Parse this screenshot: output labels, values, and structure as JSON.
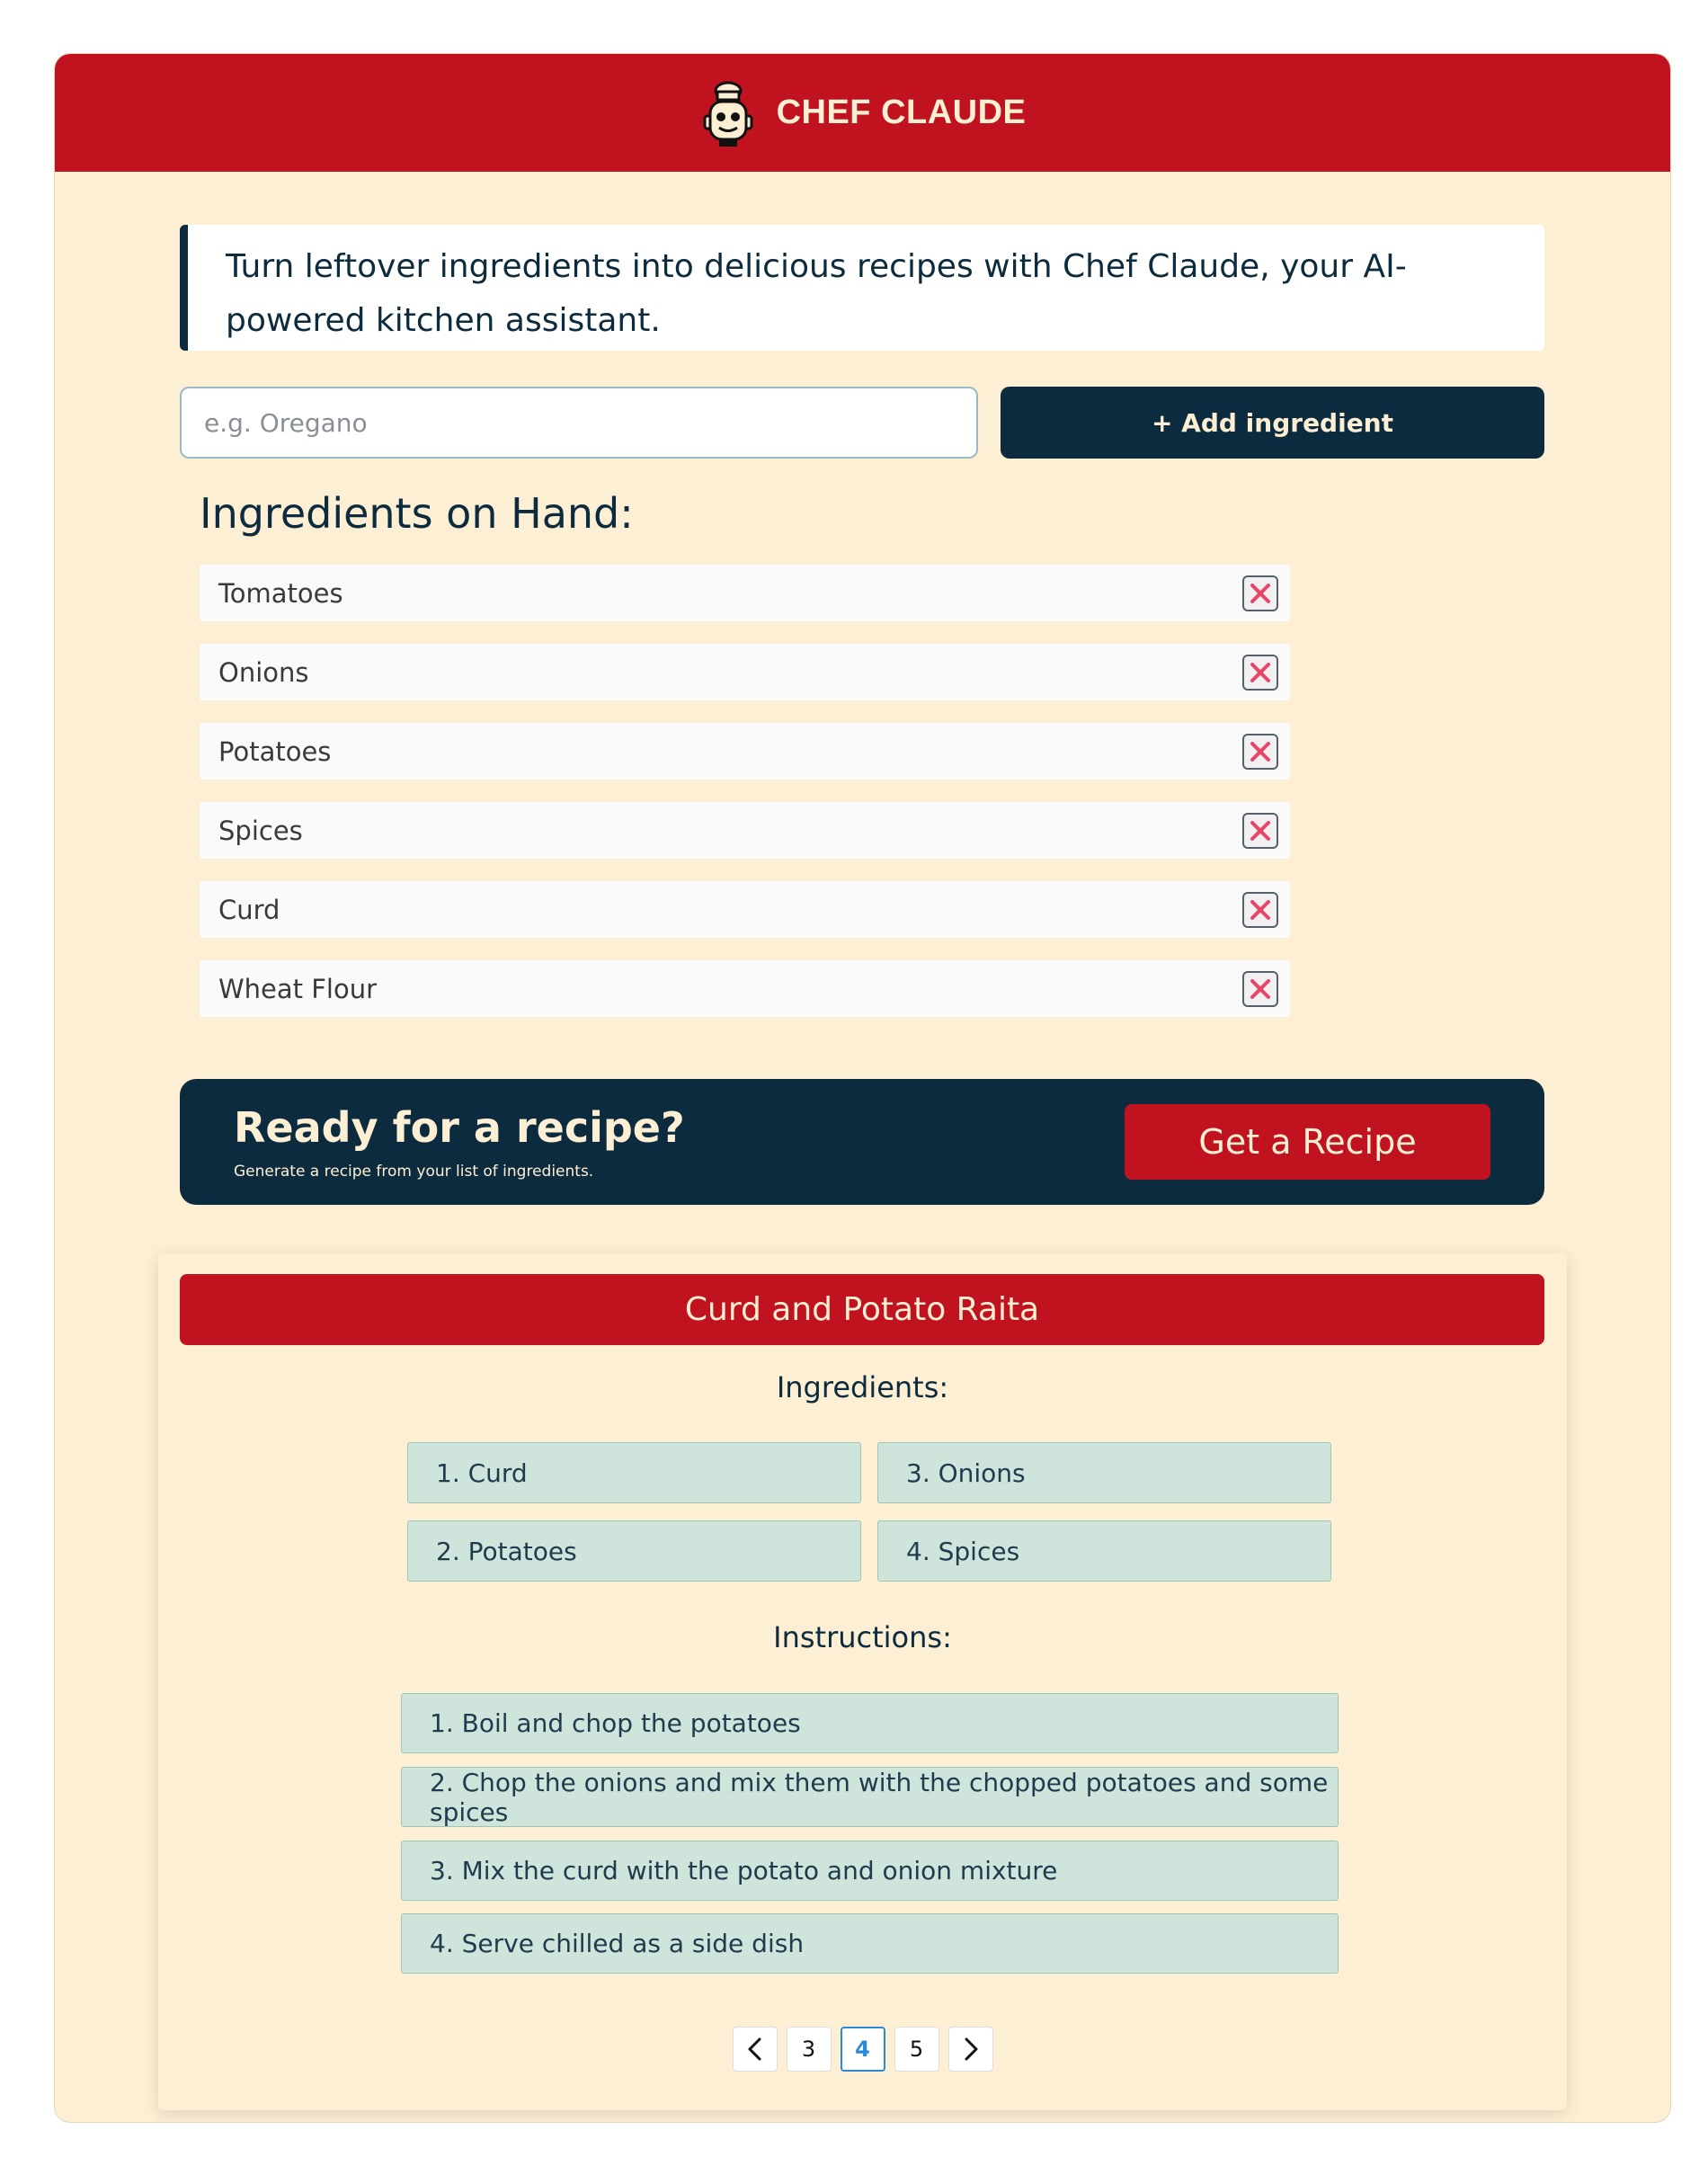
{
  "header": {
    "brand": "CHEF CLAUDE",
    "logo_icon": "chef-robot-icon"
  },
  "intro": {
    "text": "Turn leftover ingredients into delicious recipes with Chef Claude, your AI-powered kitchen assistant."
  },
  "ingredient_input": {
    "placeholder": "e.g. Oregano",
    "value": ""
  },
  "add_button": {
    "label": "+ Add ingredient"
  },
  "ingredients_list": {
    "title": "Ingredients on Hand:",
    "items": [
      {
        "name": "Tomatoes"
      },
      {
        "name": "Onions"
      },
      {
        "name": "Potatoes"
      },
      {
        "name": "Spices"
      },
      {
        "name": "Curd"
      },
      {
        "name": "Wheat Flour"
      }
    ]
  },
  "cta": {
    "title": "Ready for a recipe?",
    "subtitle": "Generate a recipe from your list of ingredients.",
    "button_label": "Get a Recipe"
  },
  "recipe": {
    "title": "Curd and Potato Raita",
    "ingredients_title": "Ingredients:",
    "ingredients": [
      "1. Curd",
      "2. Potatoes",
      "3. Onions",
      "4. Spices"
    ],
    "instructions_title": "Instructions:",
    "instructions": [
      "1. Boil and chop the potatoes",
      "2. Chop the onions and mix them with the chopped potatoes and some spices",
      "3. Mix the curd with the potato and onion mixture",
      "4. Serve chilled as a side dish"
    ]
  },
  "pagination": {
    "pages": [
      "3",
      "4",
      "5"
    ],
    "current": "4",
    "prev_icon": "chevron-left-icon",
    "next_icon": "chevron-right-icon"
  },
  "colors": {
    "brand_red": "#c1121f",
    "navy": "#0d2b3e",
    "cream": "#fdefd3",
    "chip_green": "#cfe4da",
    "remove_x": "#e8456a",
    "active_page": "#2b8ad8"
  }
}
